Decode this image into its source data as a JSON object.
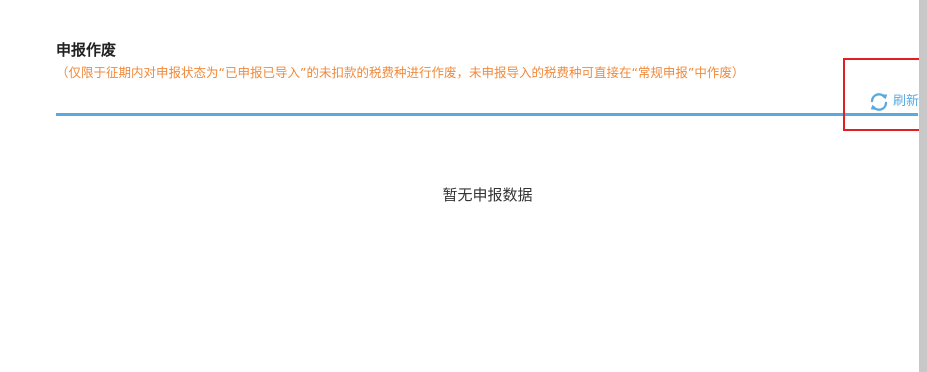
{
  "panel": {
    "title": "申报作废",
    "note": "（仅限于征期内对申报状态为“已申报已导入”的未扣款的税费种进行作废，未申报导入的税费种可直接在“常规申报”中作废）"
  },
  "toolbar": {
    "refresh_label": "刷新",
    "refresh_icon": "refresh-icon"
  },
  "content": {
    "empty_text": "暂无申报数据"
  },
  "colors": {
    "accent": "#5aaae0",
    "note": "#f08a3c",
    "highlight": "#e02020",
    "scrollbar": "#c8c8c8"
  }
}
